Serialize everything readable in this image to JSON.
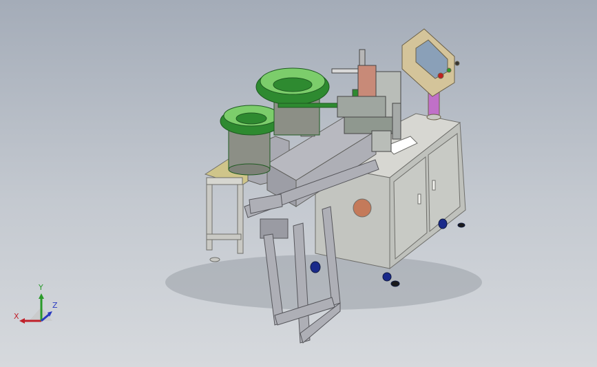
{
  "viewport": {
    "background_top": "#a4acb8",
    "background_bottom": "#d6d9dd"
  },
  "model": {
    "frame_color": "#c9c9c4",
    "panel_color": "#c2c4bf",
    "bowl_color": "#2e8a30",
    "bowl_inner_color": "#7ccd6b",
    "control_box_color": "#d4c49a",
    "screen_color": "#8aa0b8",
    "pedestal_color": "#c070c8",
    "caster_color": "#1a2a8a",
    "plate_color": "#cfc58a",
    "mechanism_color": "#c88a78"
  },
  "triad": {
    "x_label": "X",
    "y_label": "Y",
    "z_label": "Z",
    "x_color": "#c0202a",
    "y_color": "#2a9a2a",
    "z_color": "#2a3ac0"
  }
}
